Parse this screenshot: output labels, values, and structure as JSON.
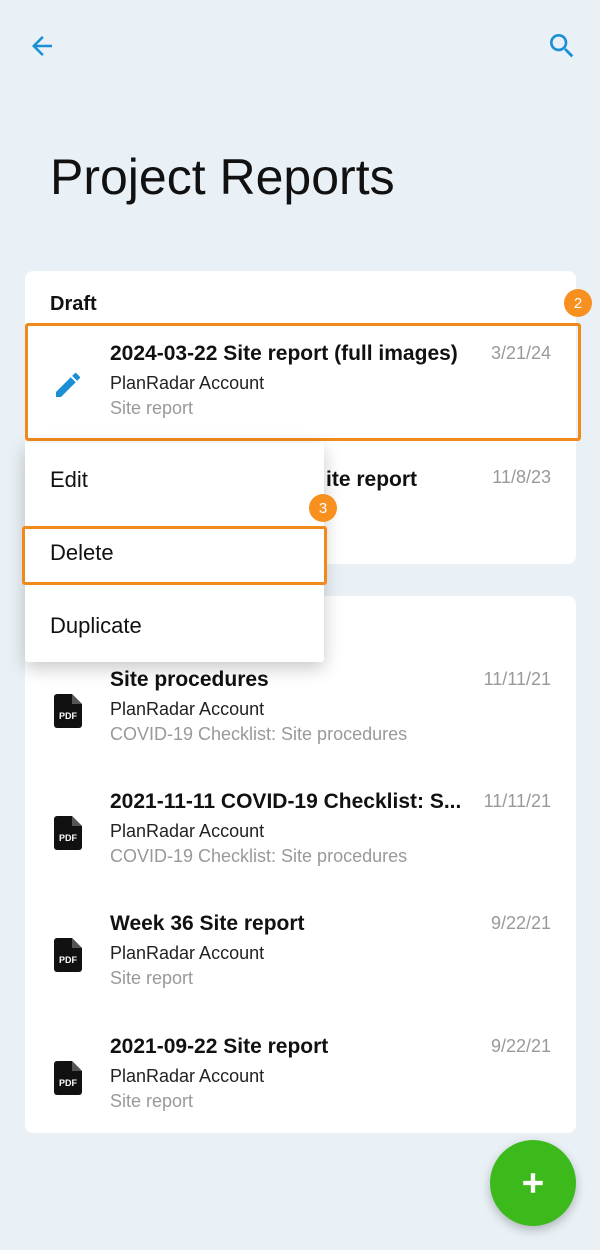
{
  "header": {
    "back_icon": "arrow-left-icon",
    "search_icon": "search-icon",
    "title": "Project Reports"
  },
  "draft_section": {
    "label": "Draft",
    "items": [
      {
        "title": "2024-03-22 Site report (full images)",
        "account": "PlanRadar Account",
        "type": "Site report",
        "date": "3/21/24",
        "icon": "pencil-icon"
      },
      {
        "title_visible_fragment": "ite report",
        "date": "11/8/23"
      }
    ]
  },
  "context_menu": {
    "items": [
      "Edit",
      "Delete",
      "Duplicate"
    ]
  },
  "published_section": {
    "items": [
      {
        "title": "Site procedures",
        "account": "PlanRadar Account",
        "type": "COVID-19 Checklist: Site procedures",
        "date": "11/11/21",
        "icon": "pdf-file-icon"
      },
      {
        "title": "2021-11-11 COVID-19 Checklist: S...",
        "account": "PlanRadar Account",
        "type": "COVID-19 Checklist: Site procedures",
        "date": "11/11/21",
        "icon": "pdf-file-icon"
      },
      {
        "title": "Week 36 Site report",
        "account": "PlanRadar Account",
        "type": "Site report",
        "date": "9/22/21",
        "icon": "pdf-file-icon"
      },
      {
        "title": "2021-09-22 Site report",
        "account": "PlanRadar Account",
        "type": "Site report",
        "date": "9/22/21",
        "icon": "pdf-file-icon"
      }
    ]
  },
  "annotations": {
    "badge_row": "2",
    "badge_delete": "3"
  },
  "fab": {
    "icon": "plus-icon"
  },
  "colors": {
    "accent": "#1a8fd6",
    "highlight": "#f08a1c",
    "fab": "#3cba1b",
    "background": "#e9f1f6"
  }
}
